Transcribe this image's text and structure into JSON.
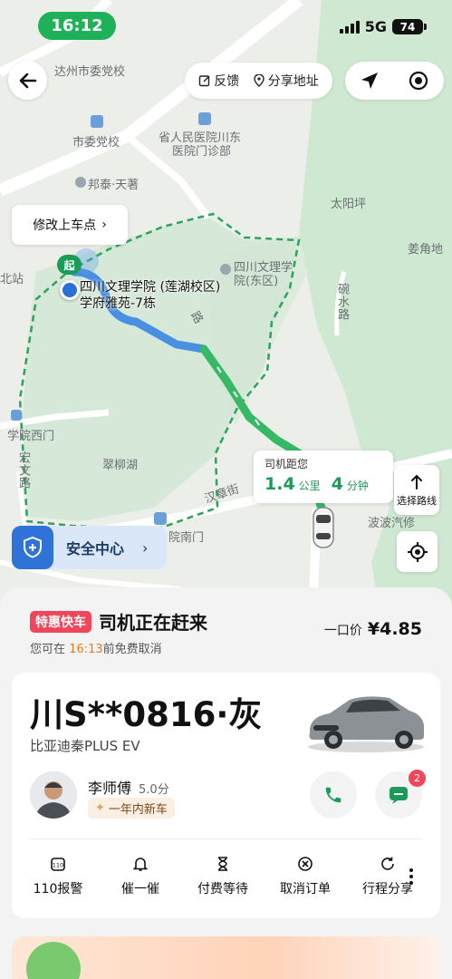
{
  "status_bar": {
    "time": "16:12",
    "network": "5G",
    "battery": "74"
  },
  "map": {
    "actions": {
      "feedback": "反馈",
      "share": "分享地址"
    },
    "modify_pickup": "修改上车点",
    "start_marker": "起",
    "pickup": {
      "line1": "四川文理学院 (莲湖校区)",
      "line2": "学府雅苑-7栋"
    },
    "labels": {
      "l1": "达州市委党校",
      "l2": "市委党校",
      "l3": "省人民医院川东",
      "l4": "医院门诊部",
      "l5": "邦泰·天著",
      "l6": "太阳坪",
      "l7": "姜角地",
      "l8": "四川文理学",
      "l9": "院(东区)",
      "l10": "碗水路",
      "l11": "北站",
      "l12": "学院西门",
      "l13": "宏文路",
      "l14": "翠柳湖",
      "l15": "汉章街",
      "l16": "院南门",
      "l17": "波波汽修",
      "l18": "路"
    },
    "driver_distance": {
      "label": "司机距您",
      "km": "1.4",
      "km_unit": "公里",
      "min": "4",
      "min_unit": "分钟"
    },
    "route_select": "选择路线",
    "safety_center": "安全中心"
  },
  "order": {
    "badge": "特惠快车",
    "status": "司机正在赶来",
    "price_label": "一口价",
    "price": "¥4.85",
    "cancel_prefix": "您可在",
    "cancel_time": "16:13",
    "cancel_suffix": "前免费取消"
  },
  "car": {
    "plate": "川S**0816·灰",
    "model": "比亚迪秦PLUS EV",
    "driver_name": "李师傅",
    "rating": "5.0分",
    "tag": "一年内新车",
    "message_count": "2"
  },
  "actions": [
    {
      "label": "110报警",
      "icon": "police-110-icon"
    },
    {
      "label": "催一催",
      "icon": "bell-icon"
    },
    {
      "label": "付费等待",
      "icon": "hourglass-icon"
    },
    {
      "label": "取消订单",
      "icon": "cancel-circle-icon"
    },
    {
      "label": "行程分享",
      "icon": "share-refresh-icon"
    }
  ],
  "colors": {
    "brand_green": "#1fb15a",
    "route_green": "#1a9c57",
    "route_blue": "#4a90e2",
    "badge_red": "#f0455a",
    "highlight_orange": "#f07a1a"
  }
}
